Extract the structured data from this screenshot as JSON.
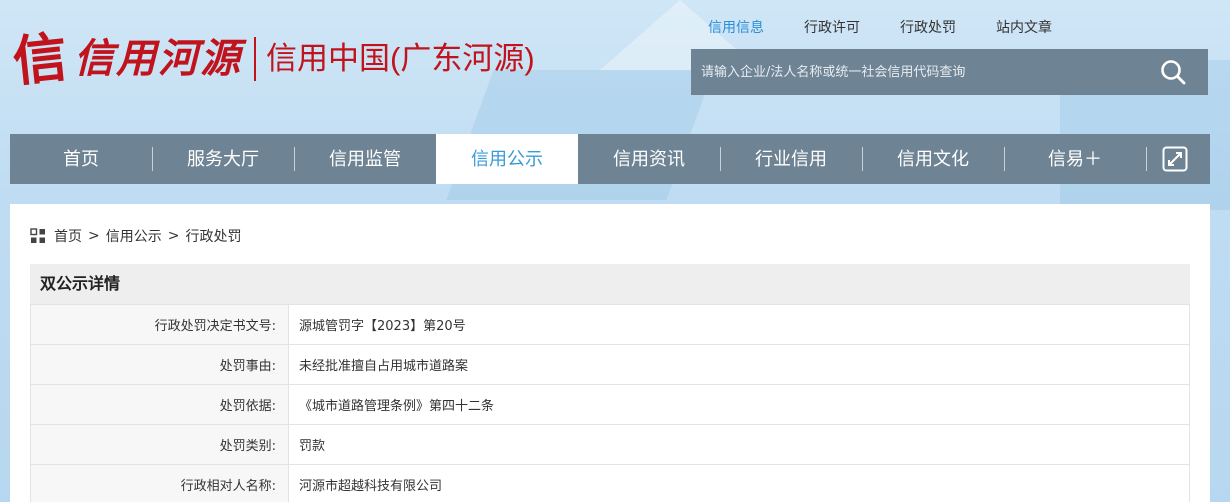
{
  "header": {
    "logo_char": "信",
    "logo_script": "信用河源",
    "logo_sub": "信用中国(广东河源)",
    "top_links": [
      {
        "label": "信用信息",
        "active": true
      },
      {
        "label": "行政许可",
        "active": false
      },
      {
        "label": "行政处罚",
        "active": false
      },
      {
        "label": "站内文章",
        "active": false
      }
    ],
    "search": {
      "placeholder": "请输入企业/法人名称或统一社会信用代码查询",
      "icon": "search-icon"
    }
  },
  "nav": {
    "items": [
      {
        "label": "首页"
      },
      {
        "label": "服务大厅"
      },
      {
        "label": "信用监管"
      },
      {
        "label": "信用公示"
      },
      {
        "label": "信用资讯"
      },
      {
        "label": "行业信用"
      },
      {
        "label": "信用文化"
      },
      {
        "label": "信易＋"
      }
    ],
    "active_index": 3,
    "expand_icon": "expand-icon"
  },
  "breadcrumb": {
    "icon": "grid-icon",
    "items": [
      "首页",
      "信用公示",
      "行政处罚"
    ],
    "separator": ">"
  },
  "detail": {
    "title": "双公示详情",
    "rows": [
      {
        "label": "行政处罚决定书文号:",
        "value": "源城管罚字【2023】第20号"
      },
      {
        "label": "处罚事由:",
        "value": "未经批准擅自占用城市道路案"
      },
      {
        "label": "处罚依据:",
        "value": "《城市道路管理条例》第四十二条"
      },
      {
        "label": "处罚类别:",
        "value": "罚款"
      },
      {
        "label": "行政相对人名称:",
        "value": "河源市超越科技有限公司"
      }
    ]
  },
  "colors": {
    "brand_red": "#c0131c",
    "nav_bg": "#6e8394",
    "active_link": "#2a8fd6"
  }
}
